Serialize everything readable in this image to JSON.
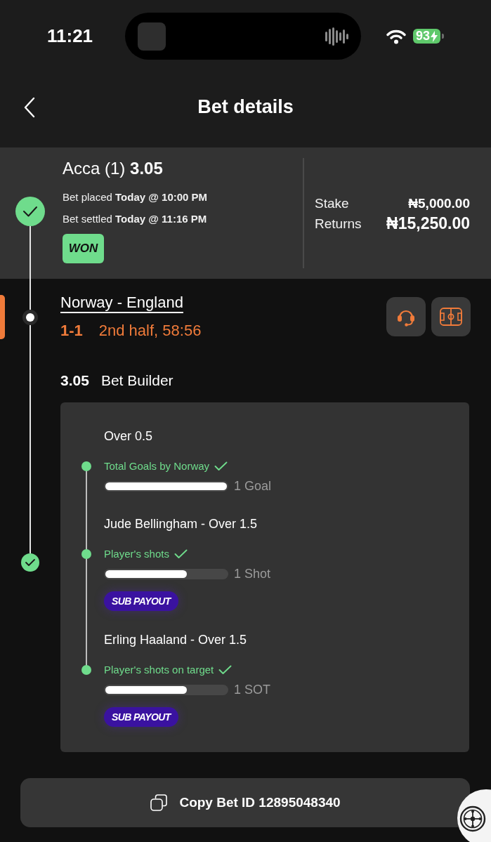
{
  "status_bar": {
    "time": "11:21",
    "battery": "93"
  },
  "header": {
    "title": "Bet details"
  },
  "bet": {
    "title": "Acca (1) **3.05**",
    "placed": "Bet placed **Today @ 10:00 PM**",
    "settled": "Bet settled **Today @ 11:16 PM**",
    "status": {
      "label": "WON",
      "kind": "won"
    },
    "amounts": [
      {
        "label": "Stake",
        "value": "₦5,000.00",
        "kind": "stake"
      },
      {
        "label": "Returns",
        "value": "₦15,250.00",
        "kind": "returns"
      }
    ]
  },
  "event": {
    "title": "Norway - England",
    "score": "1-1",
    "clock": "2nd half, 58:56",
    "live": true,
    "won": true
  },
  "bet_builder": {
    "odds": "3.05",
    "label": "Bet Builder",
    "legs": [
      {
        "selection": "Over 0.5",
        "market": "Total Goals by Norway",
        "won": true,
        "level": 1,
        "reading": "1 Goal"
      },
      {
        "selection": "Jude Bellingham - Over 1.5",
        "market": "Player's shots",
        "won": true,
        "level": 0.67,
        "reading": "1 Shot",
        "badge": "SUB PAYOUT"
      },
      {
        "selection": "Erling Haaland - Over 1.5",
        "market": "Player's shots on target",
        "won": true,
        "level": 0.67,
        "reading": "1 SOT",
        "badge": "SUB PAYOUT"
      }
    ]
  },
  "copy_button": {
    "label": "Copy Bet ID 12895048340"
  }
}
